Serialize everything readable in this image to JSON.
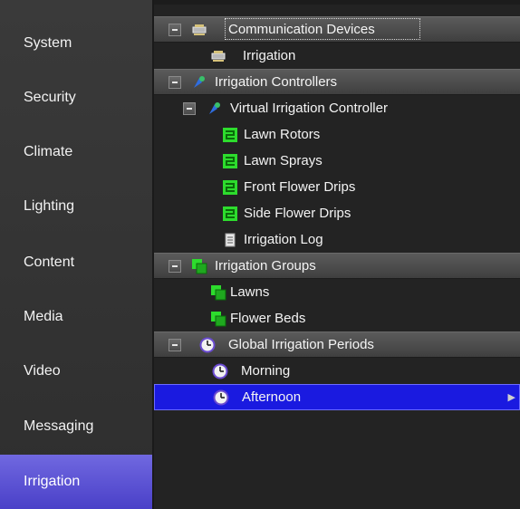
{
  "sidebar": {
    "items": [
      {
        "label": "System"
      },
      {
        "label": "Security"
      },
      {
        "label": "Climate"
      },
      {
        "label": "Lighting"
      },
      {
        "label": "Content"
      },
      {
        "label": "Media"
      },
      {
        "label": "Video"
      },
      {
        "label": "Messaging"
      },
      {
        "label": "Irrigation"
      }
    ],
    "active": "Irrigation",
    "active_color": "#5a50d8"
  },
  "tree": {
    "rows": [
      {
        "label": "Communication Devices",
        "icon": "network-device-icon"
      },
      {
        "label": "Irrigation",
        "icon": "network-device-icon"
      },
      {
        "label": "Irrigation Controllers",
        "icon": "controller-icon"
      },
      {
        "label": "Virtual Irrigation Controller",
        "icon": "controller-icon"
      },
      {
        "label": "Lawn Rotors",
        "icon": "zone-icon"
      },
      {
        "label": "Lawn Sprays",
        "icon": "zone-icon"
      },
      {
        "label": "Front Flower Drips",
        "icon": "zone-icon"
      },
      {
        "label": "Side Flower Drips",
        "icon": "zone-icon"
      },
      {
        "label": "Irrigation Log",
        "icon": "log-icon"
      },
      {
        "label": "Irrigation Groups",
        "icon": "group-icon"
      },
      {
        "label": "Lawns",
        "icon": "group-icon"
      },
      {
        "label": "Flower Beds",
        "icon": "group-icon"
      },
      {
        "label": "Global Irrigation Periods",
        "icon": "clock-icon"
      },
      {
        "label": "Morning",
        "icon": "clock-icon"
      },
      {
        "label": "Afternoon",
        "icon": "clock-icon"
      }
    ],
    "selected": "Afternoon",
    "selected_color": "#1a1ae0"
  }
}
